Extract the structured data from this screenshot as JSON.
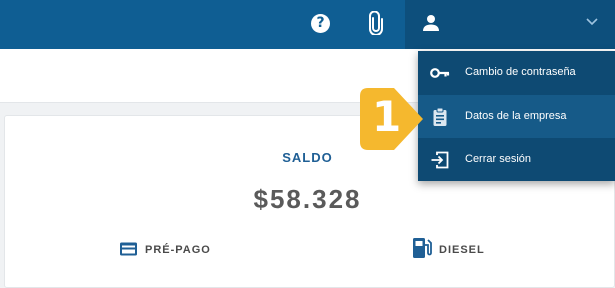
{
  "header": {
    "help_icon": "question-circle-icon",
    "attach_icon": "paperclip-icon",
    "user_icon": "person-icon",
    "dropdown_icon": "chevron-down-icon",
    "help_glyph": "?"
  },
  "balance_card": {
    "title": "SALDO",
    "amount": "$58.328",
    "plan_label": "PRÉ-PAGO",
    "fuel_label": "DIESEL"
  },
  "user_menu": {
    "items": [
      {
        "label": "Cambio de contraseña",
        "icon": "key-icon"
      },
      {
        "label": "Datos de la empresa",
        "icon": "clipboard-icon"
      },
      {
        "label": "Cerrar sesión",
        "icon": "logout-icon"
      }
    ],
    "highlighted_index": 1
  },
  "tutorial": {
    "step_number": "1",
    "badge_color": "#f5b82e"
  },
  "colors": {
    "header": "#0f5e93",
    "menu": "#0e4a73",
    "accent_text": "#1f5f95"
  }
}
